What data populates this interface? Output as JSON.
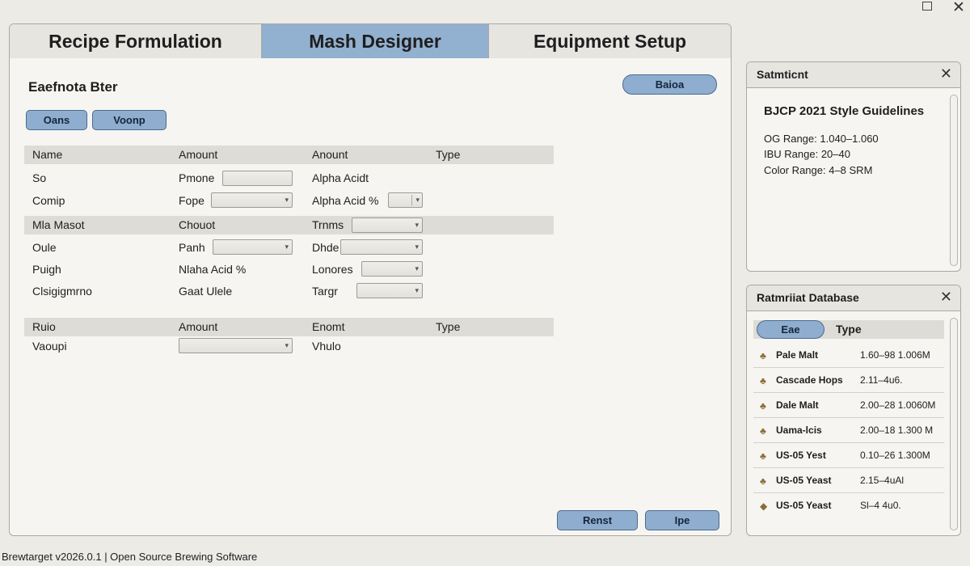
{
  "tabs": [
    "Recipe Formulation",
    "Mash Designer",
    "Equipment Setup"
  ],
  "panel": {
    "title": "Eaefnota Bter",
    "top_button": "Baioa",
    "buttons": [
      "Oans",
      "Voonp"
    ]
  },
  "table1": {
    "headers": [
      "Name",
      "Amount",
      "Anount",
      "Type"
    ],
    "rows": [
      {
        "name": "So",
        "label2": "Pmone",
        "label3": "Alpha Acidt"
      },
      {
        "name": "Comip",
        "label2": "Fope",
        "label3": "Alpha Acid %"
      }
    ]
  },
  "table2": {
    "headers": [
      "Mla Masot",
      "Chouot",
      "Trnms"
    ],
    "rows": [
      {
        "name": "Oule",
        "label2": "Panh",
        "label3": "Dhde"
      },
      {
        "name": "Puigh",
        "label2": "Nlaha Acid %",
        "label3": "Lonores"
      },
      {
        "name": "Clsigigmrno",
        "label2": "Gaat Ulele",
        "label3": "Targr"
      }
    ]
  },
  "table3": {
    "headers": [
      "Ruio",
      "Amount",
      "Enomt",
      "Type"
    ],
    "rows": [
      {
        "name": "Vaoupi",
        "label3": "Vhulo"
      }
    ]
  },
  "bottom_buttons": [
    "Renst",
    "Ipe"
  ],
  "style_panel": {
    "title": "Satmticnt",
    "heading": "BJCP 2021 Style Guidelines",
    "lines": [
      "OG Range: 1.040–1.060",
      "IBU Range: 20–40",
      "Color Range: 4–8 SRM"
    ]
  },
  "db_panel": {
    "title": "Ratmriiat Database",
    "filter_button": "Eae",
    "column_label": "Type",
    "items": [
      {
        "name": "Pale Malt",
        "value": "1.60–98 1.006M"
      },
      {
        "name": "Cascade Hops",
        "value": "2.11–4u6."
      },
      {
        "name": "Dale Malt",
        "value": "2.00–28 1.0060M"
      },
      {
        "name": "Uama-lcis",
        "value": "2.00–18 1.300 M"
      },
      {
        "name": "US-05 Yest",
        "value": "0.10–26 1.300M"
      },
      {
        "name": "US-05 Yeast",
        "value": "2.15–4uAl"
      },
      {
        "name": "US-05 Yeast",
        "value": "Sl–4 4u0."
      }
    ]
  },
  "status_bar": "Brewtarget v2026.0.1 | Open Source Brewing Software",
  "icons": [
    "maximize-icon",
    "close-icon",
    "grain-icon",
    "hop-icon",
    "yeast-icon",
    "dropdown-arrow-icon",
    "scrollbar"
  ],
  "colors": {
    "accent": "#8fadce",
    "active_tab": "#92b0cf",
    "panel_bg": "#f6f5f1",
    "window_bg": "#ecebe6"
  }
}
